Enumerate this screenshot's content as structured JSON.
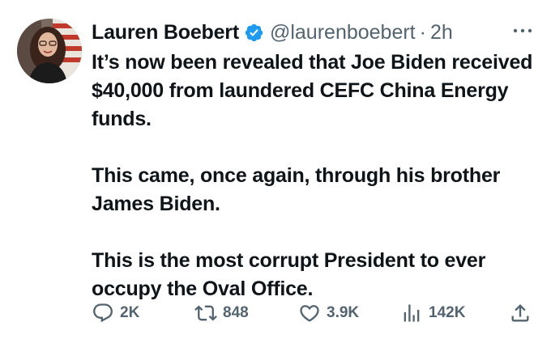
{
  "author": {
    "name": "Lauren Boebert",
    "handle": "@laurenboebert",
    "separator": "·",
    "time": "2h",
    "verified_color": "#1d9bf0"
  },
  "tweet": {
    "paragraphs": [
      "It’s now been revealed that Joe Biden received $40,000 from laundered CEFC China Energy funds.",
      "This came, once again, through his brother James Biden.",
      "This is the most corrupt President to ever occupy the Oval Office."
    ]
  },
  "actions": {
    "reply": {
      "icon": "reply-icon",
      "count": "2K"
    },
    "retweet": {
      "icon": "retweet-icon",
      "count": "848"
    },
    "like": {
      "icon": "heart-icon",
      "count": "3.9K"
    },
    "views": {
      "icon": "views-icon",
      "count": "142K"
    },
    "share": {
      "icon": "share-icon"
    }
  },
  "colors": {
    "text": "#0f1419",
    "secondary": "#536471",
    "accent": "#1d9bf0"
  }
}
